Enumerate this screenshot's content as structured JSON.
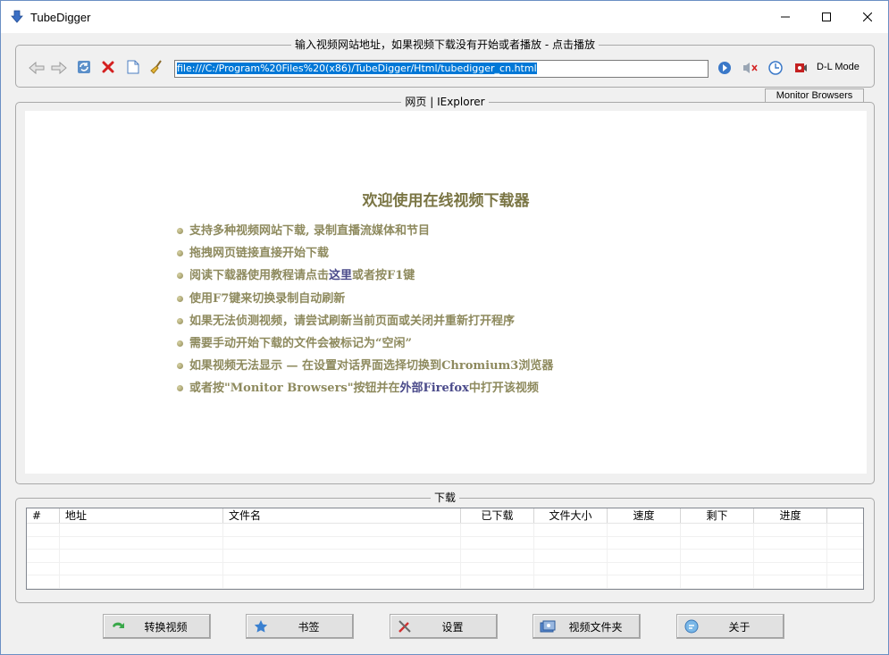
{
  "window": {
    "title": "TubeDigger"
  },
  "toolbar": {
    "group_title": "输入视频网站地址，如果视频下载没有开始或者播放 - 点击播放",
    "url_value": "file:///C:/Program%20Files%20(x86)/TubeDigger/Html/tubedigger_cn.html",
    "dl_mode_label": "D-L Mode",
    "icons": [
      "back-arrow-icon",
      "forward-arrow-icon",
      "refresh-icon",
      "stop-icon",
      "page-icon",
      "broom-icon",
      "go-icon",
      "mute-icon",
      "clock-icon",
      "record-icon"
    ]
  },
  "browser": {
    "monitor_label": "Monitor Browsers",
    "group_title": "网页 | IExplorer",
    "welcome_title": "欢迎使用在线视频下载器",
    "bullets": [
      "支持多种视频网站下载, 录制直播流媒体和节目",
      "拖拽网页链接直接开始下载",
      "使用F7键来切换录制自动刷新",
      "如果无法侦测视频，请尝试刷新当前页面或关闭并重新打开程序",
      "需要手动开始下载的文件会被标记为“空闲”"
    ],
    "bullet_help": {
      "pre": "阅读下载器使用教程请点击",
      "link": "这里",
      "post": "或者按F1键"
    },
    "bullet_chromium": {
      "pre": "如果视频无法显示 — 在设置对话界面选择切换到",
      "bold": "Chromium3",
      "post": "浏览器"
    },
    "bullet_monitor": {
      "pre": "或者按\"Monitor Browsers\"按钮并在",
      "link": "外部Firefox",
      "post": "中打开该视频"
    }
  },
  "downloads": {
    "group_title": "下载",
    "columns": [
      "#",
      "地址",
      "文件名",
      "已下载",
      "文件大小",
      "速度",
      "剩下",
      "进度"
    ],
    "rows": []
  },
  "buttons": {
    "convert": "转换视频",
    "bookmarks": "书签",
    "settings": "设置",
    "video_folder": "视频文件夹",
    "about": "关于"
  },
  "colors": {
    "title_text": "#7a7544",
    "bullet_text": "#8e8a5e",
    "link_text": "#4a4a8a",
    "selection": "#0078d7"
  }
}
